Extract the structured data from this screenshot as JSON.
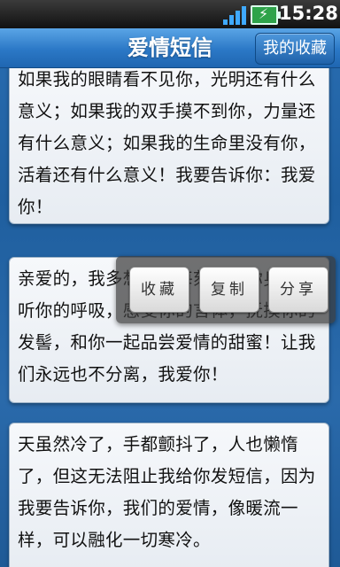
{
  "status": {
    "time": "15:28",
    "icons": [
      "signal-icon",
      "battery-charging-icon"
    ],
    "signal_color": "#3fa9ff",
    "battery_color": "#2ea34a"
  },
  "header": {
    "title": "爱情短信",
    "favorites_button": "我的收藏"
  },
  "messages": [
    {
      "text": "如果我的眼睛看不见你，光明还有什么意义；如果我的双手摸不到你，力量还有什么意义；如果我的生命里没有你，活着还有什么意义！我要告诉你：我爱你！"
    },
    {
      "text": "亲爱的，我多想每时每刻都在你身边，听你的呼吸，感受你的言体，抚摸你的发髻，和你一起品尝爱情的甜蜜！让我们永远也不分离，我爱你！"
    },
    {
      "text": "天虽然冷了，手都颤抖了，人也懒惰了，但这无法阻止我给你发短信，因为我要告诉你，我们的爱情，像暖流一样，可以融化一切寒冷。"
    }
  ],
  "popup": {
    "collect": "收藏",
    "copy": "复制",
    "share": "分享"
  }
}
